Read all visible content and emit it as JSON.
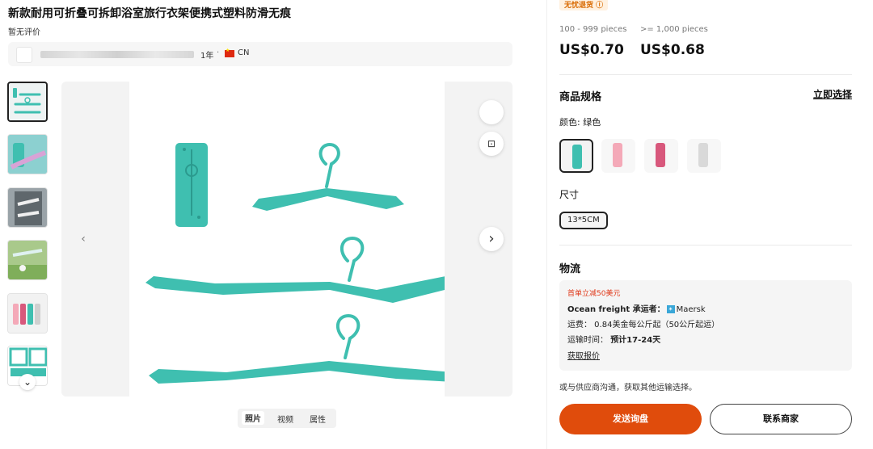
{
  "product": {
    "title": "新款耐用可折叠可拆卸浴室旅行衣架便携式塑料防滑无痕",
    "review_status": "暂无评价"
  },
  "supplier": {
    "years": "1年",
    "separator": "·",
    "country": "CN"
  },
  "gallery": {
    "thumbnails": [
      "hanger-collage",
      "hanger-green-closeup",
      "hanger-wardrobe",
      "hanger-outdoor",
      "hanger-colors",
      "hanger-diagram"
    ],
    "media_tabs": [
      "照片",
      "视频",
      "属性"
    ],
    "active_tab": "照片"
  },
  "pricing": {
    "badge": "无忧退货 ⓘ",
    "tiers": [
      {
        "range": "100 - 999 pieces",
        "price": "US$0.70"
      },
      {
        "range": ">= 1,000 pieces",
        "price": "US$0.68"
      }
    ]
  },
  "specs": {
    "title": "商品规格",
    "select_now": "立即选择",
    "color_label": "颜色: 绿色",
    "colors": [
      {
        "name": "green",
        "hex": "#3fbfb0",
        "selected": true
      },
      {
        "name": "pink",
        "hex": "#f4a9b8",
        "selected": false
      },
      {
        "name": "rose",
        "hex": "#d8587c",
        "selected": false
      },
      {
        "name": "gray",
        "hex": "#d9d9d9",
        "selected": false
      }
    ],
    "size_label": "尺寸",
    "size_value": "13*5CM"
  },
  "logistics": {
    "title": "物流",
    "promo": "首单立减50美元",
    "carrier_prefix": "Ocean freight 承运者：",
    "carrier": "Maersk",
    "fee": "运费：  0.84美金每公斤起（50公斤起运）",
    "time_label": "运输时间：",
    "time_value": "预计17-24天",
    "quote_link": "获取报价",
    "other_note": "或与供应商沟通，获取其他运输选择。"
  },
  "actions": {
    "inquiry": "发送询盘",
    "contact": "联系商家"
  },
  "colors": {
    "accent": "#e04c0c",
    "product": "#3fbfb0"
  }
}
